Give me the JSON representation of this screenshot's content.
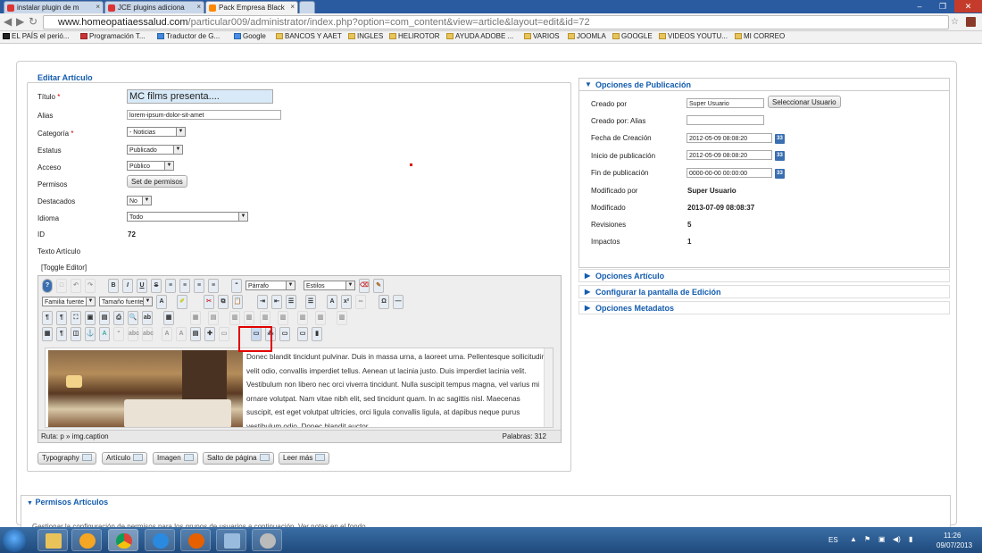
{
  "tabs": [
    {
      "label": "instalar plugin de m"
    },
    {
      "label": "JCE plugins adiciona"
    },
    {
      "label": "Pack Empresa Black"
    }
  ],
  "window_controls": {
    "min": "–",
    "max": "❐",
    "close": "✕"
  },
  "url": {
    "host": "www.homeopatiaessalud.com",
    "path": "/particular009/administrator/index.php?option=com_content&view=article&layout=edit&id=72"
  },
  "bookmarks": [
    "EL PAÍS el perió...",
    "Programación T...",
    "Traductor de G...",
    "Google",
    "BANCOS Y AAET",
    "INGLES",
    "HELIROTOR",
    "AYUDA ADOBE ...",
    "VARIOS",
    "JOOMLA",
    "GOOGLE",
    "VIDEOS YOUTU...",
    "MI CORREO"
  ],
  "form": {
    "legend": "Editar Artículo",
    "titulo_label": "Título",
    "titulo_value": "MC films presenta....",
    "alias_label": "Alias",
    "alias_value": "lorem-ipsum-dolor-sit-amet",
    "categoria_label": "Categoría",
    "categoria_value": "- Noticias",
    "estatus_label": "Estatus",
    "estatus_value": "Publicado",
    "acceso_label": "Acceso",
    "acceso_value": "Público",
    "permisos_label": "Permisos",
    "permisos_button": "Set de permisos",
    "destacados_label": "Destacados",
    "destacados_value": "No",
    "idioma_label": "Idioma",
    "idioma_value": "Todo",
    "id_label": "ID",
    "id_value": "72",
    "texto_label": "Texto Artículo",
    "toggle_editor": "[Toggle Editor]",
    "required_mark": "*"
  },
  "editor": {
    "format_select": "Párrafo",
    "styles_select": "Estilos",
    "font_family": "Familia fuente",
    "font_size": "Tamaño fuente",
    "body_text": "Donec blandit tincidunt pulvinar. Duis in massa urna, a laoreet urna. Pellentesque sollicitudin velit odio, convallis imperdiet tellus. Aenean ut lacinia justo. Duis imperdiet lacinia velit. Vestibulum non libero nec orci viverra tincidunt. Nulla suscipit tempus magna, vel varius mi ornare volutpat. Nam vitae nibh elit, sed tincidunt quam. In ac sagittis nisl. Maecenas suscipit, est eget volutpat ultricies, orci ligula convallis ligula, at dapibus neque purus vestibulum odio. Donec blandit auctor",
    "path": "Ruta:  p » img.caption",
    "words": "Palabras: 312"
  },
  "extra_buttons": [
    "Typography",
    "Artículo",
    "Imagen",
    "Salto de página",
    "Leer más"
  ],
  "publicacion": {
    "title": "Opciones de Publicación",
    "creado_por_label": "Creado por",
    "creado_por_value": "Super Usuario",
    "select_user_button": "Seleccionar Usuario",
    "alias_label": "Creado por: Alias",
    "fecha_creacion_label": "Fecha de Creación",
    "fecha_creacion_value": "2012-05-09 08:08:20",
    "inicio_label": "Inicio de publicación",
    "inicio_value": "2012-05-09 08:08:20",
    "fin_label": "Fin de publicación",
    "fin_value": "0000-00-00 00:00:00",
    "modificado_por_label": "Modificado por",
    "modificado_por_value": "Super Usuario",
    "modificado_label": "Modificado",
    "modificado_value": "2013-07-09 08:08:37",
    "revisiones_label": "Revisiones",
    "revisiones_value": "5",
    "impactos_label": "Impactos",
    "impactos_value": "1",
    "cal_icon": "33"
  },
  "collapsed_panels": [
    "Opciones Artículo",
    "Configurar la pantalla de Edición",
    "Opciones Metadatos"
  ],
  "permisos": {
    "title": "Permisos Artículos",
    "text": "Gestionar la configuración de permisos para los grupos de usuarios a continuación. Ver notas en el fondo."
  },
  "tray": {
    "lang": "ES",
    "time": "11:26",
    "date": "09/07/2013"
  }
}
